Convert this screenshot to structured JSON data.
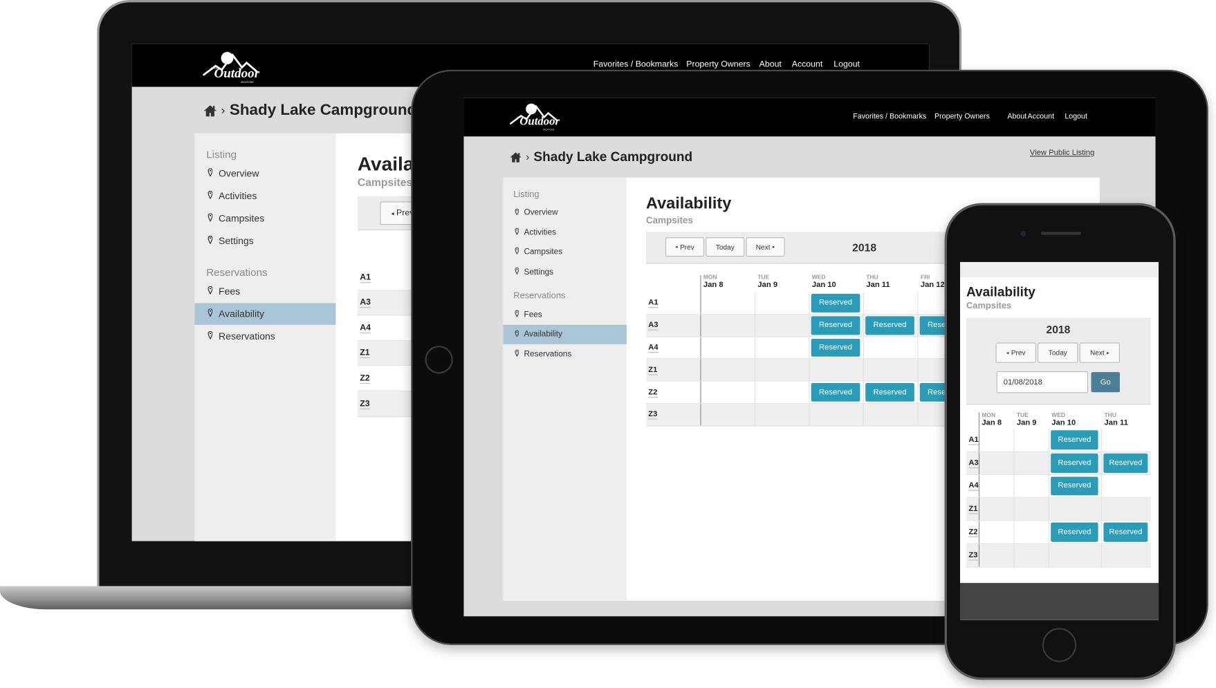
{
  "brand": {
    "logo_text": "Outdoor",
    "logo_small_top": "GREAT",
    "logo_small_bottom": "VACATIONS"
  },
  "nav": [
    {
      "label": "Favorites / Bookmarks"
    },
    {
      "label": "Property Owners"
    },
    {
      "label": "About"
    },
    {
      "label": "Account"
    },
    {
      "label": "Logout"
    }
  ],
  "breadcrumb": {
    "title": "Shady Lake Campground",
    "view_public": "View Public Listing"
  },
  "sidebar": {
    "sections": [
      {
        "heading": "Listing",
        "items": [
          {
            "label": "Overview"
          },
          {
            "label": "Activities"
          },
          {
            "label": "Campsites"
          },
          {
            "label": "Settings"
          }
        ]
      },
      {
        "heading": "Reservations",
        "items": [
          {
            "label": "Fees"
          },
          {
            "label": "Availability"
          },
          {
            "label": "Reservations"
          }
        ]
      }
    ],
    "active": "Availability"
  },
  "availability": {
    "title": "Availability",
    "title_truncated": "Availa",
    "subtitle": "Campsites",
    "year": "2018",
    "prev": "Prev",
    "today": "Today",
    "next": "Next",
    "date_value": "01/08/2018",
    "go": "Go",
    "reserved_label": "Reserved",
    "days": [
      {
        "dow": "MON",
        "date": "Jan 8"
      },
      {
        "dow": "TUE",
        "date": "Jan 9"
      },
      {
        "dow": "WED",
        "date": "Jan 10"
      },
      {
        "dow": "THU",
        "date": "Jan 11"
      },
      {
        "dow": "FRI",
        "date": "Jan 12"
      }
    ],
    "sites": [
      {
        "id": "A1",
        "reserved": [
          2
        ]
      },
      {
        "id": "A3",
        "reserved": [
          2,
          3,
          4
        ]
      },
      {
        "id": "A4",
        "reserved": [
          2
        ]
      },
      {
        "id": "Z1",
        "reserved": []
      },
      {
        "id": "Z2",
        "reserved": [
          2,
          3,
          4
        ]
      },
      {
        "id": "Z3",
        "reserved": []
      }
    ]
  },
  "colors": {
    "reserved": "#2b9cb8",
    "active_sidebar": "#a9c5d6",
    "go_button": "#4a7f96",
    "header": "#000000"
  }
}
